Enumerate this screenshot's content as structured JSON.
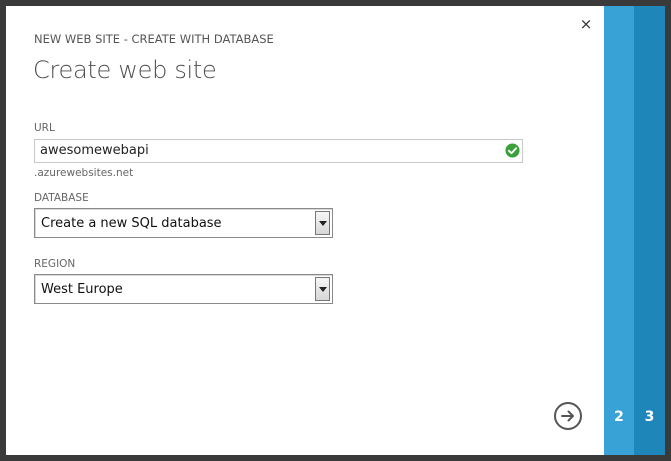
{
  "dialog": {
    "subtitle": "NEW WEB SITE - CREATE WITH DATABASE",
    "title": "Create web site",
    "close_icon": "close-icon",
    "close_glyph": "×"
  },
  "form": {
    "url_label": "URL",
    "url_value": "awesomewebapi",
    "url_suffix": ".azurewebsites.net",
    "url_valid_icon": "check-icon",
    "database_label": "DATABASE",
    "database_value": "Create a new SQL database",
    "region_label": "REGION",
    "region_value": "West Europe"
  },
  "wizard": {
    "next_icon": "arrow-right-icon",
    "steps": [
      "2",
      "3"
    ]
  },
  "colors": {
    "valid": "#3aa03a",
    "step2": "#38a2d6",
    "step3": "#1f86ba"
  }
}
